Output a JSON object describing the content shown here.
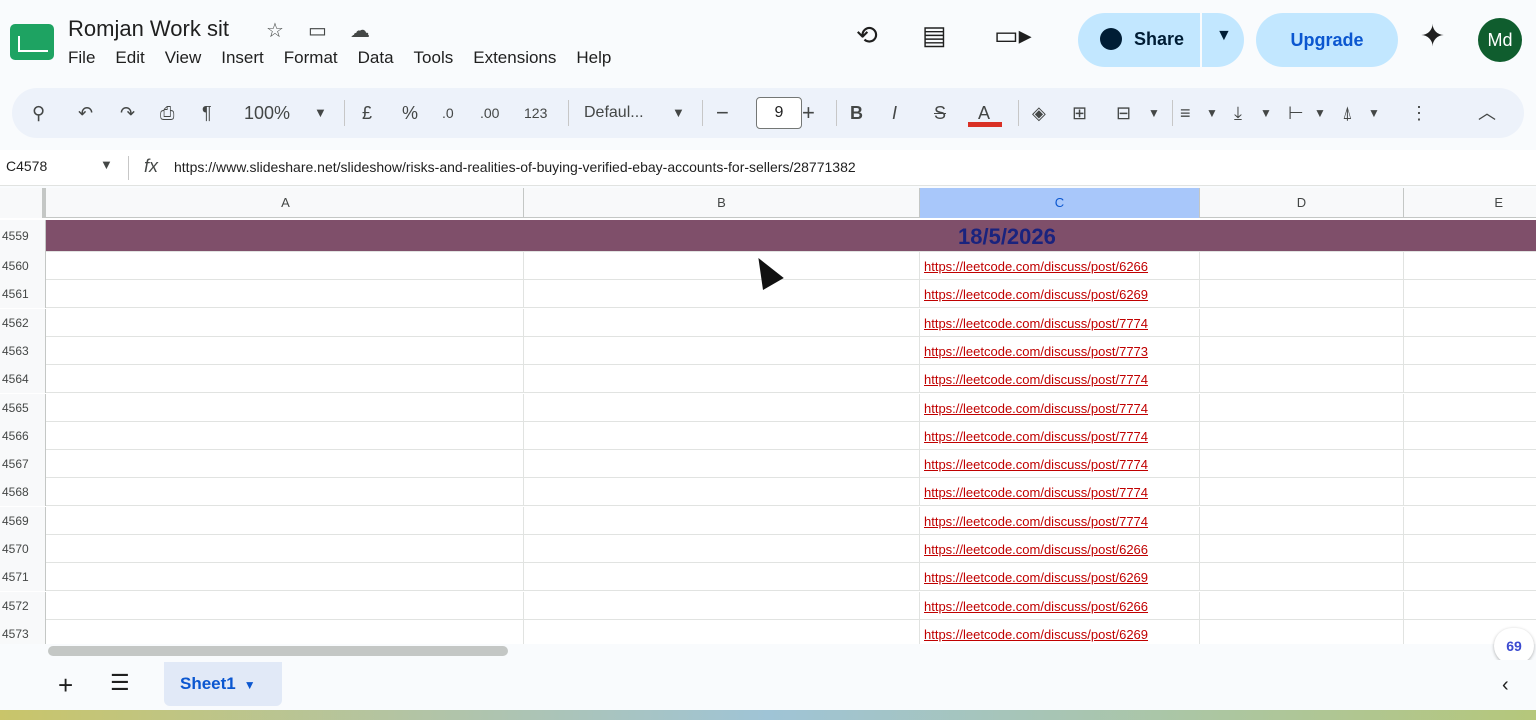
{
  "app": {
    "doc_title": "Romjan Work sit",
    "menu": [
      "File",
      "Edit",
      "View",
      "Insert",
      "Format",
      "Data",
      "Tools",
      "Extensions",
      "Help"
    ],
    "share_label": "Share",
    "upgrade_label": "Upgrade",
    "avatar_initials": "Md"
  },
  "toolbar": {
    "zoom": "100%",
    "currency": "£",
    "percent": "%",
    "decrease_decimal": ".0",
    "increase_decimal": ".00",
    "number_format": "123",
    "font": "Defaul...",
    "font_size": "9",
    "minus": "−",
    "plus": "+",
    "bold": "B",
    "italic": "I",
    "strike": "S",
    "text_color": "A"
  },
  "formula_bar": {
    "name_box": "C4578",
    "fx": "fx",
    "content": "https://www.slideshare.net/slideshow/risks-and-realities-of-buying-verified-ebay-accounts-for-sellers/28771382"
  },
  "columns": [
    "A",
    "B",
    "C",
    "D",
    "E"
  ],
  "header_row": {
    "num": "4559",
    "date": "18/5/2026",
    "color": "#7f4f6a"
  },
  "rows": [
    {
      "num": "4560",
      "link": "https://leetcode.com/discuss/post/6266"
    },
    {
      "num": "4561",
      "link": "https://leetcode.com/discuss/post/6269"
    },
    {
      "num": "4562",
      "link": "https://leetcode.com/discuss/post/7774"
    },
    {
      "num": "4563",
      "link": "https://leetcode.com/discuss/post/7773"
    },
    {
      "num": "4564",
      "link": "https://leetcode.com/discuss/post/7774"
    },
    {
      "num": "4565",
      "link": "https://leetcode.com/discuss/post/7774"
    },
    {
      "num": "4566",
      "link": "https://leetcode.com/discuss/post/7774"
    },
    {
      "num": "4567",
      "link": "https://leetcode.com/discuss/post/7774"
    },
    {
      "num": "4568",
      "link": "https://leetcode.com/discuss/post/7774"
    },
    {
      "num": "4569",
      "link": "https://leetcode.com/discuss/post/7774"
    },
    {
      "num": "4570",
      "link": "https://leetcode.com/discuss/post/6266"
    },
    {
      "num": "4571",
      "link": "https://leetcode.com/discuss/post/6269"
    },
    {
      "num": "4572",
      "link": "https://leetcode.com/discuss/post/6266"
    },
    {
      "num": "4573",
      "link": "https://leetcode.com/discuss/post/6269"
    }
  ],
  "sheet_tab": "Sheet1",
  "badge": "69",
  "colors": {
    "link": "#c00000",
    "accent": "#0b57d0",
    "share_bg": "#c2e7ff"
  }
}
